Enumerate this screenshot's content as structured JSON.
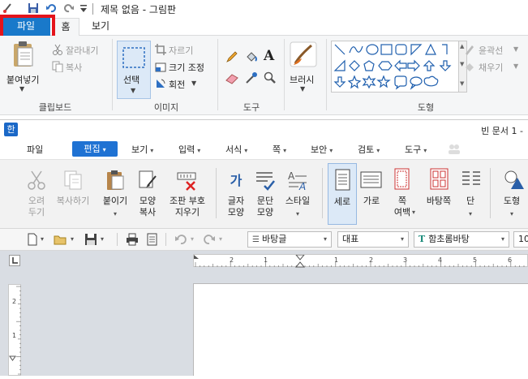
{
  "paint": {
    "window_title": "제목 없음 - 그림판",
    "tabs": {
      "file": "파일",
      "home": "홈",
      "view": "보기"
    },
    "clipboard": {
      "paste": "붙여넣기",
      "cut": "잘라내기",
      "copy": "복사",
      "group": "클립보드"
    },
    "image": {
      "select": "선택",
      "crop": "자르기",
      "resize": "크기 조정",
      "rotate": "회전",
      "group": "이미지"
    },
    "tools": {
      "group": "도구",
      "text_glyph": "A"
    },
    "brushes": {
      "label": "브러시"
    },
    "shapes": {
      "outline": "윤곽선",
      "fill": "채우기",
      "group": "도형"
    }
  },
  "hwp": {
    "logo": "한",
    "doc_title": "빈 문서 1 -",
    "menu": {
      "file": "파일",
      "edit": "편집",
      "view": "보기",
      "insert": "입력",
      "format": "서식",
      "page": "쪽",
      "security": "보안",
      "review": "검토",
      "tools": "도구"
    },
    "toolbar": {
      "cut": [
        "오려",
        "두기"
      ],
      "copy": "복사하기",
      "paste": "붙이기",
      "format_copy": [
        "모양",
        "복사"
      ],
      "erase_marks": [
        "조판 부호",
        "지우기"
      ],
      "char_shape": [
        "글자",
        "모양"
      ],
      "para_shape": [
        "문단",
        "모양"
      ],
      "style": "스타일",
      "vertical": "세로",
      "horizontal": "가로",
      "width_margin": [
        "쪽",
        "여백"
      ],
      "background": "바탕쪽",
      "columns": "단",
      "shape": "도형",
      "char_icon": "가"
    },
    "format_bar": {
      "style": "바탕글",
      "lang": "대표",
      "font": "함초롬바탕",
      "size": "10",
      "font_icon": "T"
    },
    "ruler": {
      "h_ticks": [
        "2",
        "1",
        "1",
        "2",
        "3",
        "4",
        "5",
        "6"
      ],
      "v_ticks": [
        "2",
        "1"
      ]
    }
  }
}
